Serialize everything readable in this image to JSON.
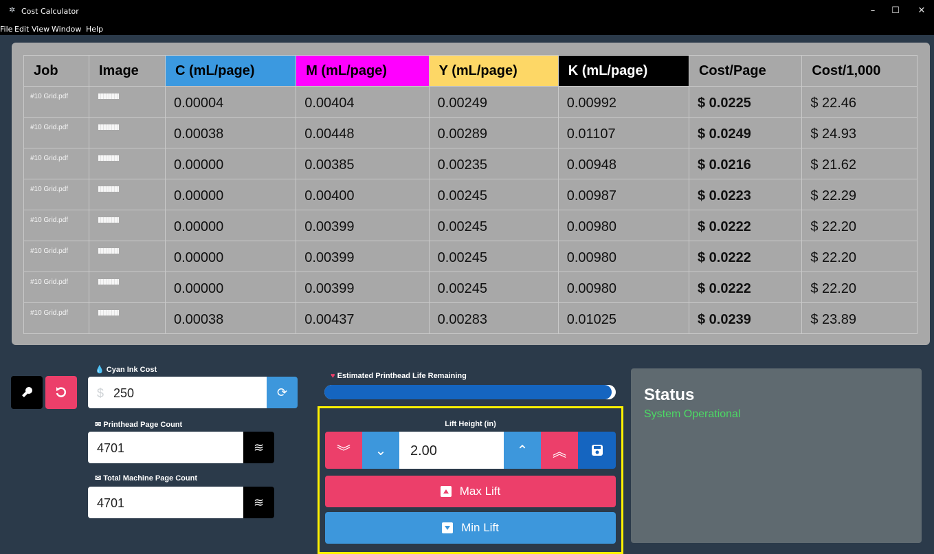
{
  "window": {
    "title": "Cost Calculator",
    "controls": [
      "–",
      "☐",
      "✕"
    ]
  },
  "menu": [
    "File",
    "Edit",
    "View",
    "Window",
    "Help"
  ],
  "table": {
    "headers": [
      "Job",
      "Image",
      "C (mL/page)",
      "M (mL/page)",
      "Y (mL/page)",
      "K (mL/page)",
      "Cost/Page",
      "Cost/1,000"
    ],
    "header_colors": {
      "C": "#3b99e0",
      "M": "#ff00ff",
      "Y": "#fdd766",
      "K": "#000000"
    },
    "rows": [
      {
        "job": "#10 Grid.pdf",
        "c": "0.00004",
        "m": "0.00404",
        "y": "0.00249",
        "k": "0.00992",
        "cost_page": "$ 0.0225",
        "cost_1000": "$ 22.46"
      },
      {
        "job": "#10 Grid.pdf",
        "c": "0.00038",
        "m": "0.00448",
        "y": "0.00289",
        "k": "0.01107",
        "cost_page": "$ 0.0249",
        "cost_1000": "$ 24.93"
      },
      {
        "job": "#10 Grid.pdf",
        "c": "0.00000",
        "m": "0.00385",
        "y": "0.00235",
        "k": "0.00948",
        "cost_page": "$ 0.0216",
        "cost_1000": "$ 21.62"
      },
      {
        "job": "#10 Grid.pdf",
        "c": "0.00000",
        "m": "0.00400",
        "y": "0.00245",
        "k": "0.00987",
        "cost_page": "$ 0.0223",
        "cost_1000": "$ 22.29"
      },
      {
        "job": "#10 Grid.pdf",
        "c": "0.00000",
        "m": "0.00399",
        "y": "0.00245",
        "k": "0.00980",
        "cost_page": "$ 0.0222",
        "cost_1000": "$ 22.20"
      },
      {
        "job": "#10 Grid.pdf",
        "c": "0.00000",
        "m": "0.00399",
        "y": "0.00245",
        "k": "0.00980",
        "cost_page": "$ 0.0222",
        "cost_1000": "$ 22.20"
      },
      {
        "job": "#10 Grid.pdf",
        "c": "0.00000",
        "m": "0.00399",
        "y": "0.00245",
        "k": "0.00980",
        "cost_page": "$ 0.0222",
        "cost_1000": "$ 22.20"
      },
      {
        "job": "#10 Grid.pdf",
        "c": "0.00038",
        "m": "0.00437",
        "y": "0.00283",
        "k": "0.01025",
        "cost_page": "$ 0.0239",
        "cost_1000": "$ 23.89"
      }
    ]
  },
  "controls": {
    "cyan_ink_cost": {
      "label": "Cyan Ink Cost",
      "currency": "$",
      "value": "250"
    },
    "printhead_page_count": {
      "label": "Printhead Page Count",
      "value": "4701"
    },
    "total_machine_page_count": {
      "label": "Total Machine Page Count",
      "value": "4701"
    }
  },
  "printhead_life": {
    "label": "Estimated Printhead Life Remaining",
    "fraction": 0.985
  },
  "lift": {
    "label": "Lift Height (in)",
    "value": "2.00",
    "max_label": "Max Lift",
    "min_label": "Min Lift"
  },
  "status": {
    "title": "Status",
    "text": "System Operational"
  },
  "colors": {
    "pink": "#ec3f6a",
    "blue": "#3d97dc",
    "dark_blue": "#1565c0",
    "highlight": "#fff200"
  }
}
